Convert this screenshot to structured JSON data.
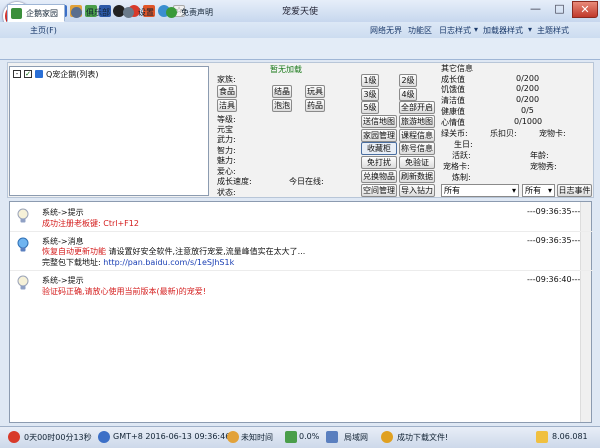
{
  "window": {
    "title": "宠爱天使",
    "minimize": "—",
    "maximize": "□",
    "close": "✕"
  },
  "quick_icons": [
    "bulb-icon",
    "book-icon",
    "people-icon",
    "recycle-icon",
    "disk-icon",
    "qq-icon",
    "stop-icon",
    "chili-icon",
    "globe-icon",
    "star-icon"
  ],
  "menu": {
    "home": "主页(F)",
    "items": [
      "网络无界",
      "功能区",
      "日志样式",
      "加载器样式",
      "主题样式"
    ]
  },
  "tabs": [
    "企鹅家园",
    "俱乐部",
    "设置",
    "免责声明"
  ],
  "tree": {
    "root": "Q宠企鹅(列表)"
  },
  "pet": {
    "status": "暂无加载",
    "home_label": "家族:",
    "items": [
      "食品",
      "结晶",
      "玩具",
      "洁具",
      "泡泡",
      "药品"
    ],
    "stats_left": [
      "等级:",
      "元宝",
      "武力:",
      "智力:",
      "魅力:",
      "爱心:",
      "成长速度:",
      "状态:"
    ],
    "online": "今日在线:",
    "level_buttons": [
      "1级",
      "2级",
      "3级",
      "4级",
      "5级",
      "全部开启"
    ],
    "actions": [
      "送信地图",
      "旅游地图",
      "家园管理",
      "课程信息",
      "收藏柜",
      "称号信息",
      "免打扰",
      "免验证",
      "兑换物品",
      "刷新数据",
      "空间管理",
      "导入钻力"
    ]
  },
  "other": {
    "header": "其它信息",
    "bars": [
      {
        "label": "成长值",
        "value": "0/200"
      },
      {
        "label": "饥饿值",
        "value": "0/200"
      },
      {
        "label": "清洁值",
        "value": "0/200"
      },
      {
        "label": "健康值",
        "value": "0/5"
      },
      {
        "label": "心情值",
        "value": "0/1000"
      }
    ],
    "coins": "绿关币:",
    "lebei": "乐扣贝:",
    "petnum": "宠物卡:",
    "birthday": "生日:",
    "active": "活跃:",
    "age": "年龄:",
    "card": "宠格卡:",
    "petstore": "宠物秀:",
    "grow": "炼制:",
    "filter1": "所有",
    "filter2": "所有",
    "log_button": "日志事件"
  },
  "log": [
    {
      "title": "系统->提示",
      "time": "---09:36:35---",
      "line1": "成功注册老板键: Ctrl+F12",
      "line2": ""
    },
    {
      "title": "系统->消息",
      "time": "---09:36:35---",
      "line1": "恢复自动更新功能 请设置好安全软件,注意放行宠爱,流量峰值实在太大了...",
      "line1_red": "恢复自动更新功能",
      "line1_rest": " 请设置好安全软件,注意放行宠爱,流量峰值实在太大了...",
      "line2_label": "完整包下载地址: ",
      "line2_link": "http://pan.baidu.com/s/1eSJhS1k"
    },
    {
      "title": "系统->提示",
      "time": "---09:36:40---",
      "line1": "验证码正确,请放心使用当前版本(最新)的宠爱!",
      "line2": ""
    }
  ],
  "status": {
    "uptime": "0天00时00分13秒",
    "clock": "GMT+8 2016-06-13 09:36:46",
    "unknown": "未知时间",
    "percent": "0.0%",
    "net": "局域网",
    "download": "成功下载文件!",
    "version": "8.06.081"
  }
}
